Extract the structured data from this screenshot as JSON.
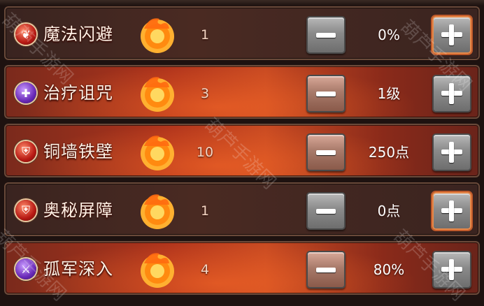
{
  "skills": [
    {
      "name": "魔法闪避",
      "icon": "feather-icon",
      "icon_color": "red",
      "count": "1",
      "value": "0%",
      "style": "dark"
    },
    {
      "name": "治疗诅咒",
      "icon": "cursed-heal-icon",
      "icon_color": "purple",
      "count": "3",
      "value": "1级",
      "style": "red"
    },
    {
      "name": "铜墙铁壁",
      "icon": "shield-icon",
      "icon_color": "red",
      "count": "10",
      "value": "250点",
      "style": "red"
    },
    {
      "name": "奥秘屏障",
      "icon": "arcane-shield-icon",
      "icon_color": "red",
      "count": "1",
      "value": "0点",
      "style": "dark"
    },
    {
      "name": "孤军深入",
      "icon": "crossed-swords-icon",
      "icon_color": "purple",
      "count": "4",
      "value": "80%",
      "style": "red"
    }
  ],
  "watermark_text": "葫芦手游网",
  "colors": {
    "accent": "#c84a22",
    "panel_dark": "#3a2420",
    "text": "#fff2e6"
  }
}
